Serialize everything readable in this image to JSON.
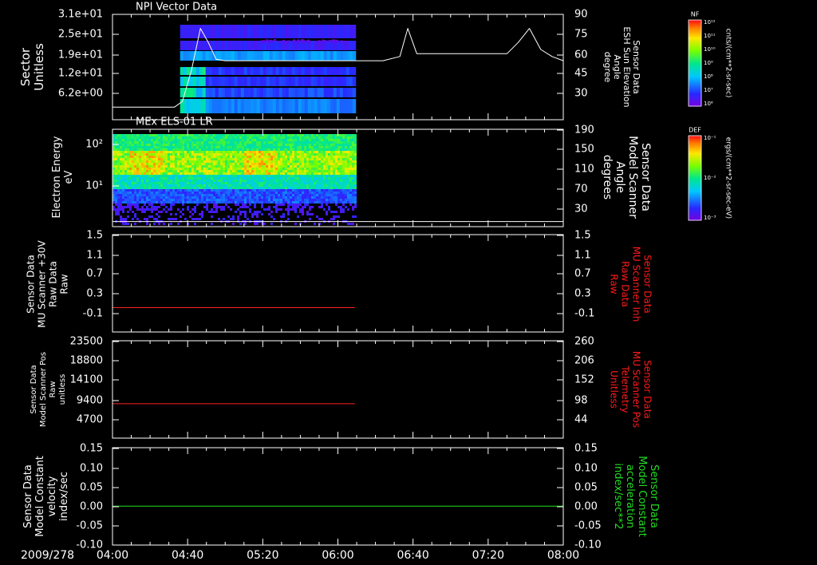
{
  "date_label": "2009/278",
  "x_ticks": [
    "04:00",
    "04:40",
    "05:20",
    "06:00",
    "06:40",
    "07:20",
    "08:00"
  ],
  "colors": {
    "background": "#000000",
    "axis": "#ffffff",
    "trace_red": "#ff2020",
    "trace_green": "#20e020",
    "right_label_red": "#ff1a1a",
    "right_label_green": "#22dd22"
  },
  "chart_data": [
    {
      "type": "heatmap",
      "title": "NPI Vector Data",
      "ylabel_lines": [
        "Sector",
        "Unitless"
      ],
      "y_ticks_left": [
        "3.1e+01",
        "2.5e+01",
        "1.9e+01",
        "1.2e+01",
        "6.2e+00"
      ],
      "right_axis": {
        "label_lines": [
          "Sensor Data",
          "ESH Sun Elevation",
          "Angle",
          "degree"
        ],
        "ticks": [
          "90",
          "75",
          "60",
          "45",
          "30"
        ],
        "ylim": [
          15,
          90
        ]
      },
      "data_extent_hours": [
        4.6,
        6.15
      ],
      "line_series": {
        "name": "ESH Sun Elevation Angle",
        "x_hours": [
          4.0,
          4.55,
          4.62,
          4.7,
          4.78,
          4.85,
          4.92,
          5.0,
          5.5,
          6.0,
          6.4,
          6.55,
          6.62,
          6.7,
          6.85,
          7.2,
          7.5,
          7.6,
          7.7,
          7.8,
          7.9,
          8.0
        ],
        "values": [
          24,
          24,
          28,
          50,
          80,
          70,
          58,
          57,
          57,
          57,
          57,
          60,
          80,
          62,
          62,
          62,
          62,
          70,
          80,
          65,
          60,
          57
        ]
      },
      "colorbar": {
        "title": "NF",
        "unit": "cnts/(cm**2-sr-sec)",
        "tick_labels": [
          "10¹²",
          "10¹¹",
          "10¹⁰",
          "10⁹",
          "10⁸",
          "10⁷",
          "10⁶"
        ]
      }
    },
    {
      "type": "heatmap",
      "title": "MEx ELS-01 LR",
      "ylabel_lines": [
        "Electron Energy",
        "eV"
      ],
      "y_ticks_left": [
        "10²",
        "10¹"
      ],
      "right_axis": {
        "label_lines": [
          "Sensor Data",
          "Model Scanner",
          "Angle",
          "degrees"
        ],
        "ticks": [
          "190",
          "150",
          "110",
          "70",
          "30"
        ],
        "ylim": [
          0,
          190
        ]
      },
      "data_extent_hours": [
        4.0,
        6.15
      ],
      "line_series": {
        "name": "Model Scanner Angle",
        "x_hours": [
          4.0,
          8.0
        ],
        "values": [
          10,
          10
        ]
      },
      "colorbar": {
        "title": "DEF",
        "unit": "ergs/(cm**2-sr-sec-eV)",
        "tick_labels": [
          "10⁻¹",
          "10⁻²",
          "10⁻³"
        ]
      }
    },
    {
      "type": "line",
      "ylabel_lines": [
        "Sensor Data",
        "MU Scanner +30V",
        "Raw Data",
        "Raw"
      ],
      "y_ticks": [
        "1.5",
        "1.1",
        "0.7",
        "0.3",
        "-0.1"
      ],
      "ylim": [
        -0.5,
        1.5
      ],
      "right_axis": {
        "label_lines": [
          "Sensor Data",
          "MU Scanner Inh",
          "Raw Data",
          "Raw"
        ],
        "ticks": [
          "1.5",
          "1.1",
          "0.7",
          "0.3",
          "-0.1"
        ]
      },
      "series": [
        {
          "x_hours": [
            4.0,
            6.15
          ],
          "values": [
            0.0,
            0.0
          ],
          "color": "#ff2020"
        }
      ]
    },
    {
      "type": "line",
      "ylabel_lines": [
        "Sensor Data",
        "Model Scanner Pos",
        "Raw",
        "unitless"
      ],
      "y_ticks": [
        "23500",
        "18800",
        "14100",
        "9400",
        "4700"
      ],
      "ylim": [
        0,
        23500
      ],
      "right_axis": {
        "label_lines": [
          "Sensor Data",
          "MU Scanner Pos",
          "Telemetry",
          "Unitless"
        ],
        "ticks": [
          "260",
          "206",
          "152",
          "98",
          "44"
        ]
      },
      "series": [
        {
          "x_hours": [
            4.0,
            6.15
          ],
          "values": [
            8300,
            8300
          ],
          "color": "#ff2020"
        }
      ]
    },
    {
      "type": "line",
      "ylabel_lines": [
        "Sensor Data",
        "Model Constant",
        "velocity",
        "index/sec"
      ],
      "y_ticks": [
        "0.15",
        "0.10",
        "0.05",
        "0.00",
        "-0.05",
        "-0.10"
      ],
      "ylim": [
        -0.1,
        0.15
      ],
      "right_axis": {
        "label_lines": [
          "Sensor Data",
          "Model Constant",
          "acceleration",
          "index/sec**2"
        ],
        "ticks": [
          "0.15",
          "0.10",
          "0.05",
          "0.00",
          "-0.05",
          "-0.10"
        ]
      },
      "series": [
        {
          "x_hours": [
            4.0,
            8.0
          ],
          "values": [
            0.0,
            0.0
          ],
          "color": "#20e020"
        }
      ]
    }
  ]
}
